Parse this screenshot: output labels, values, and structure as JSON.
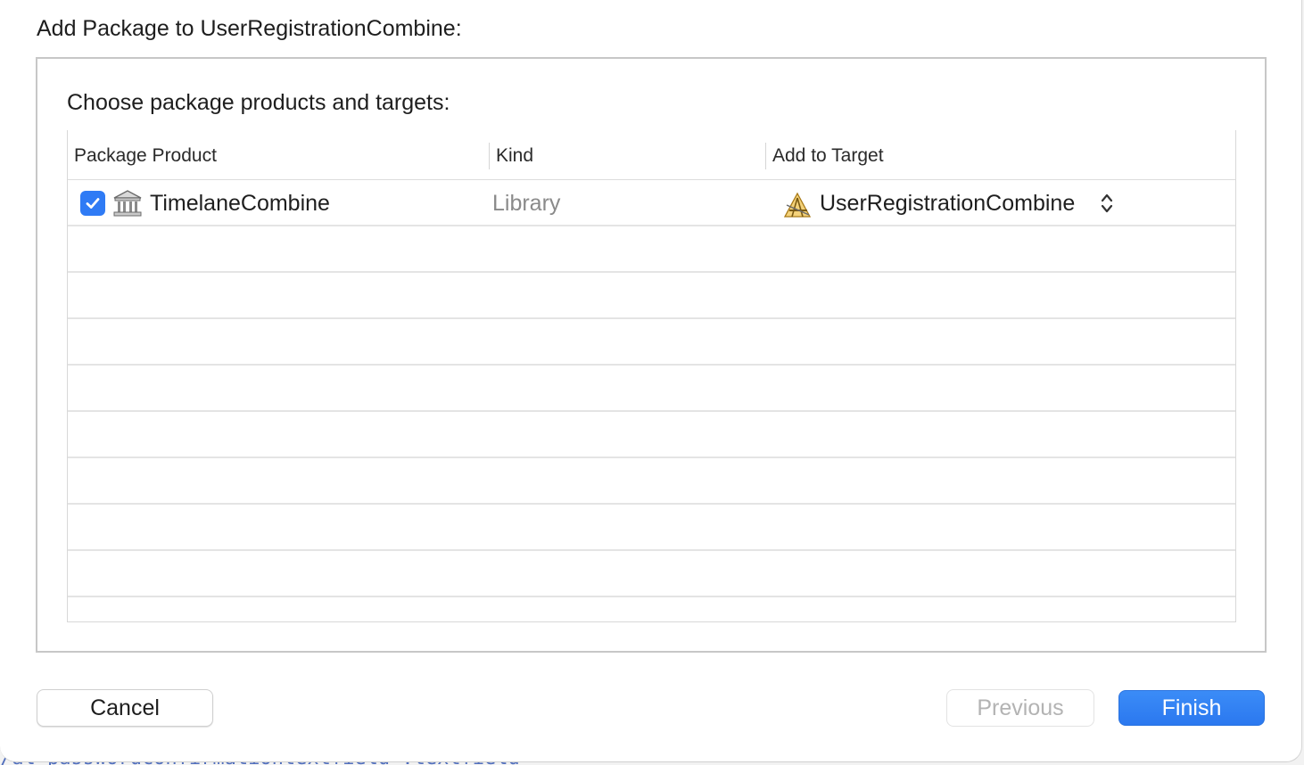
{
  "dialog": {
    "title": "Add Package to UserRegistrationCombine:",
    "subtitle": "Choose package products and targets:"
  },
  "table": {
    "columns": [
      "Package Product",
      "Kind",
      "Add to Target"
    ],
    "rows": [
      {
        "checked": true,
        "product": "TimelaneCombine",
        "kind": "Library",
        "target": "UserRegistrationCombine",
        "product_icon": "library-icon",
        "target_icon": "app-target-icon"
      }
    ],
    "empty_rows": 9
  },
  "buttons": {
    "cancel": "Cancel",
    "previous": "Previous",
    "finish": "Finish"
  },
  "background": {
    "code_fragment": "/al-passwordconfirmationtextfield-.textfield"
  },
  "colors": {
    "accent": "#2f7bf5",
    "disabled_text": "#b3b3b3",
    "kind_text": "#8a8a8a"
  }
}
